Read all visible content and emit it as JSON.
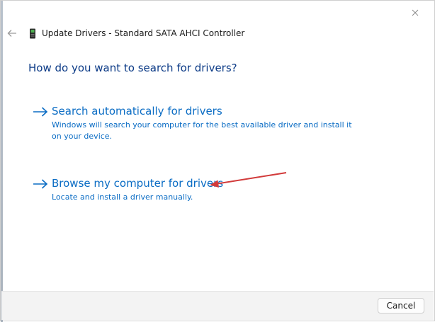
{
  "window": {
    "title": "Update Drivers - Standard SATA AHCI Controller"
  },
  "question": "How do you want to search for drivers?",
  "options": [
    {
      "title": "Search automatically for drivers",
      "description": "Windows will search your computer for the best available driver and install it on your device."
    },
    {
      "title": "Browse my computer for drivers",
      "description": "Locate and install a driver manually."
    }
  ],
  "footer": {
    "cancel_label": "Cancel"
  },
  "icons": {
    "close": "close-icon",
    "back": "back-arrow-icon",
    "device": "device-icon",
    "option_arrow": "right-arrow-icon",
    "annotation": "red-pointer-arrow"
  },
  "colors": {
    "link": "#0a6cc4",
    "heading": "#0b3a86",
    "annotation": "#d23b3b"
  }
}
